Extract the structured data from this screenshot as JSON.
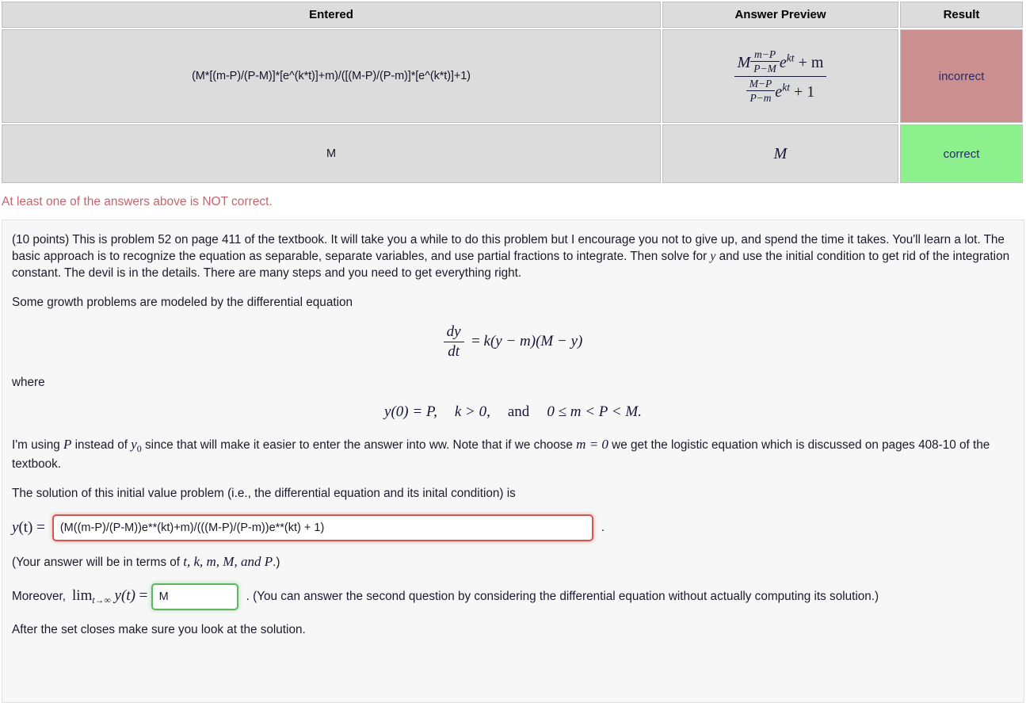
{
  "results_table": {
    "headers": [
      "Entered",
      "Answer Preview",
      "Result"
    ],
    "rows": [
      {
        "entered": "(M*[(m-P)/(P-M)]*[e^(k*t)]+m)/([(M-P)/(P-m)]*[e^(k*t)]+1)",
        "preview": {
          "type": "fraction",
          "numerator": "M (m-P)/(P-M) e^{kt} + m",
          "denominator": "(M-P)/(P-m) e^{kt} + 1",
          "num_leading": "M",
          "num_frac_top": "m−P",
          "num_frac_bottom": "P−M",
          "num_exp_base": "e",
          "num_exp_sup": "kt",
          "num_tail": "+ m",
          "den_frac_top": "M−P",
          "den_frac_bottom": "P−m",
          "den_exp_base": "e",
          "den_exp_sup": "kt",
          "den_tail": "+ 1"
        },
        "result": "incorrect",
        "result_color": "#cc8f8f"
      },
      {
        "entered": "M",
        "preview": {
          "type": "plain",
          "text": "M"
        },
        "result": "correct",
        "result_color": "#8cf08c"
      }
    ]
  },
  "warning": {
    "text": "At least one of the answers above is NOT correct.",
    "color": "#c5646e"
  },
  "problem": {
    "intro_part1": "(10 points) This is problem 52 on page 411 of the textbook. It will take you a while to do this problem but I encourage you not to give up, and spend the time it takes. You'll learn a lot. The basic approach is to recognize the equation as separable, separate variables, and use partial fractions to integrate. Then solve for ",
    "intro_var_y": "y",
    "intro_part2": " and use the initial condition to get rid of the integration constant. The devil is in the details. There are many steps and you need to get everything right.",
    "growth_line": "Some growth problems are modeled by the differential equation",
    "de": {
      "lhs_num": "dy",
      "lhs_den": "dt",
      "equals": "=",
      "rhs": "k(y − m)(M − y)"
    },
    "where_label": "where",
    "conditions": {
      "c1": "y(0) = P,",
      "c2": "k > 0,",
      "and_word": "and",
      "c3": "0 ≤ m < P < M."
    },
    "using_p_part1": "I'm using ",
    "using_p_var1": "P",
    "using_p_part2": " instead of ",
    "using_p_var2": "y",
    "using_p_var2_sub": "0",
    "using_p_part3": " since that will make it easier to enter the answer into ww. Note that if we choose ",
    "using_p_var3": "m = 0",
    "using_p_part4": " we get the logistic equation which is discussed on pages 408-10 of the textbook.",
    "solution_line": "The solution of this initial value problem (i.e., the differential equation and its inital condition) is",
    "answer1": {
      "label_y": "y",
      "label_t": "(t)",
      "label_eq": "=",
      "value": "(M((m-P)/(P-M))e**(kt)+m)/(((M-P)/(P-m))e**(kt) + 1)",
      "placeholder": "",
      "trailing": ".",
      "border_color": "#d9534f",
      "state": "incorrect"
    },
    "terms_note_part1": "(Your answer will be in terms of ",
    "terms_note_vars": "t, k, m, M, and P",
    "terms_note_part2": ".)",
    "moreover": {
      "lead_word": "Moreover,",
      "lim_word": "lim",
      "lim_sub": "t→∞",
      "fn": "y(t)",
      "equals": "=",
      "value": "M",
      "placeholder": "",
      "border_color": "#5cb85c",
      "state": "correct",
      "tail": ". (You can answer the second question by considering the differential equation without actually computing its solution.)"
    },
    "closing_line": "After the set closes make sure you look at the solution."
  }
}
